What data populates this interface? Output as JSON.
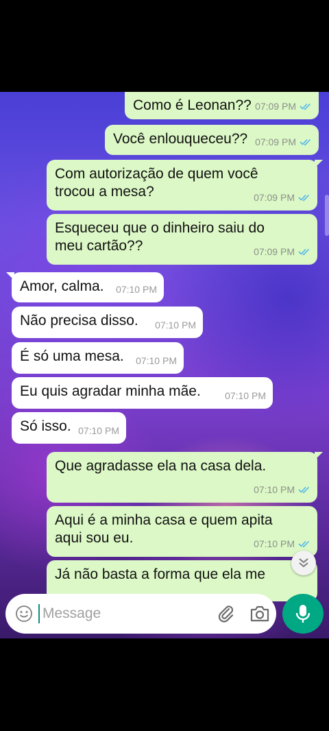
{
  "messages": [
    {
      "text": "Como é Leonan??",
      "time": "07:09 PM",
      "dir": "out",
      "status": "read"
    },
    {
      "text": "Você enlouqueceu??",
      "time": "07:09 PM",
      "dir": "out",
      "status": "read"
    },
    {
      "text": "Com autorização de quem você\ntrocou a mesa?",
      "time": "07:09 PM",
      "dir": "out",
      "status": "read"
    },
    {
      "text": "Esqueceu que o dinheiro saiu do\nmeu cartão??",
      "time": "07:09 PM",
      "dir": "out",
      "status": "read"
    },
    {
      "text": "Amor, calma.",
      "time": "07:10 PM",
      "dir": "in"
    },
    {
      "text": "Não precisa disso.",
      "time": "07:10 PM",
      "dir": "in"
    },
    {
      "text": "É só uma mesa.",
      "time": "07:10 PM",
      "dir": "in"
    },
    {
      "text": "Eu quis agradar minha mãe.",
      "time": "07:10 PM",
      "dir": "in"
    },
    {
      "text": "Só isso.",
      "time": "07:10 PM",
      "dir": "in"
    },
    {
      "text": "Que agradasse ela na casa dela.",
      "time": "07:10 PM",
      "dir": "out",
      "status": "read"
    },
    {
      "text": "Aqui é a minha casa e quem apita\naqui sou eu.",
      "time": "07:10 PM",
      "dir": "out",
      "status": "read"
    },
    {
      "text": "Já não basta a forma que ela me",
      "time": "",
      "dir": "out"
    }
  ],
  "composer": {
    "placeholder": "Message",
    "emoji_icon": "emoji-icon",
    "attach_icon": "paperclip-icon",
    "camera_icon": "camera-icon",
    "mic_icon": "mic-icon"
  },
  "colors": {
    "outgoing_bubble": "#dcf8c6",
    "incoming_bubble": "#ffffff",
    "read_tick": "#4fb6ec",
    "mic_button": "#00a884"
  }
}
